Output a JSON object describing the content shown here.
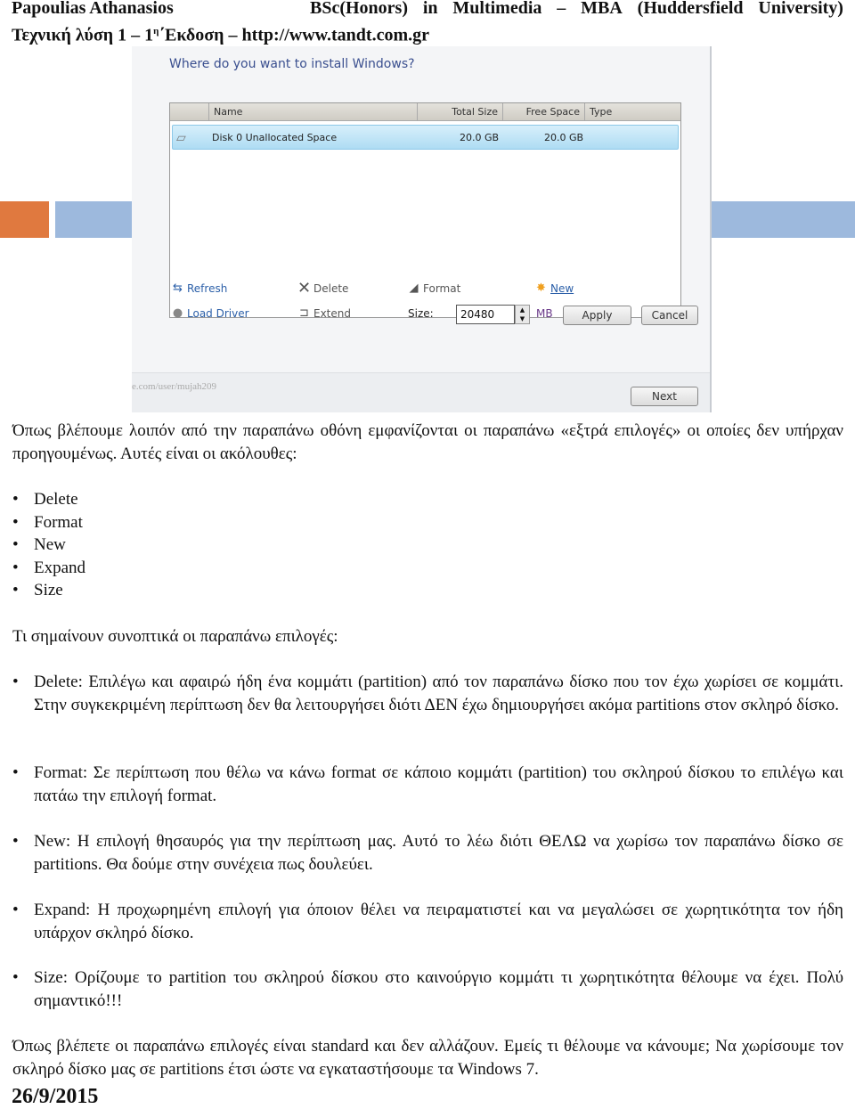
{
  "header": {
    "author": "Papoulias Athanasios",
    "degree_parts": [
      "BSc(Honors)",
      "in",
      "Multimedia",
      "–",
      "MBA",
      "(Huddersfield",
      "University)"
    ],
    "subtitle_pre": "Τεχνική λύση 1 – 1",
    "subtitle_sup": "η",
    "subtitle_post": "΄Εκδοση – http://www.tandt.com.gr"
  },
  "colors": {
    "orange": "#e0793f",
    "blue": "#9db9dd"
  },
  "screenshot": {
    "title": "Where do you want to install Windows?",
    "columns": [
      "Name",
      "Total Size",
      "Free Space",
      "Type"
    ],
    "rows": [
      {
        "name": "Disk 0 Unallocated Space",
        "total": "20.0 GB",
        "free": "20.0 GB",
        "type": ""
      }
    ],
    "actions": {
      "refresh": "Refresh",
      "delete": "Delete",
      "format": "Format",
      "new": "New",
      "load_driver": "Load Driver",
      "extend": "Extend"
    },
    "size_label": "Size:",
    "size_value": "20480",
    "size_unit": "MB",
    "apply": "Apply",
    "cancel": "Cancel",
    "next": "Next",
    "watermark": "e.com/user/mujah209"
  },
  "body": {
    "p1": "Όπως βλέπουμε λοιπόν από την παραπάνω οθόνη εμφανίζονται οι παραπάνω «εξτρά επιλογές» οι οποίες δεν υπήρχαν προηγουμένως. Αυτές είναι οι ακόλουθες:",
    "list": [
      "Delete",
      "Format",
      "New",
      "Expand",
      "Size"
    ],
    "p2": "Τι σημαίνουν συνοπτικά οι παραπάνω επιλογές:",
    "details": [
      "Delete: Επιλέγω και αφαιρώ ήδη ένα κομμάτι (partition) από τον παραπάνω δίσκο που τον έχω χωρίσει σε κομμάτι. Στην συγκεκριμένη περίπτωση δεν θα λειτουργήσει διότι ΔΕΝ έχω δημιουργήσει ακόμα partitions στον σκληρό δίσκο.",
      "Format: Σε περίπτωση που θέλω να κάνω format σε κάποιο κομμάτι (partition) του σκληρού δίσκου το επιλέγω και πατάω την επιλογή format.",
      "New: Η επιλογή θησαυρός για την περίπτωση μας. Αυτό το λέω διότι ΘΕΛΩ να χωρίσω τον παραπάνω δίσκο σε partitions. Θα δούμε στην συνέχεια πως δουλεύει.",
      "Expand: Η προχωρημένη επιλογή για όποιον θέλει να πειραματιστεί και να μεγαλώσει σε χωρητικότητα τον ήδη υπάρχον σκληρό δίσκο.",
      "Size: Ορίζουμε το partition του σκληρού δίσκου στο καινούργιο κομμάτι τι χωρητικότητα θέλουμε να έχει. Πολύ σημαντικό!!!"
    ],
    "p3": "Όπως βλέπετε οι παραπάνω επιλογές είναι standard και δεν αλλάζουν. Εμείς τι θέλουμε να κάνουμε; Να χωρίσουμε τον σκληρό δίσκο μας σε partitions έτσι ώστε να εγκαταστήσουμε τα Windows 7."
  },
  "footer": {
    "date": "26/9/2015"
  }
}
